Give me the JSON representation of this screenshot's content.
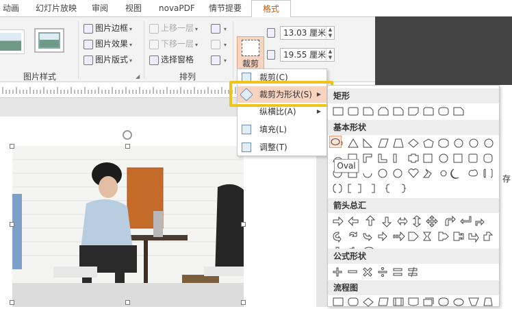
{
  "tabs": [
    "动画",
    "幻灯片放映",
    "审阅",
    "视图",
    "novaPDF",
    "情节提要",
    "格式"
  ],
  "ribbon": {
    "picture_border": "图片边框",
    "picture_effect": "图片效果",
    "picture_layout": "图片版式",
    "bring_forward": "上移一层",
    "send_backward": "下移一层",
    "selection_pane": "选择窗格",
    "crop": "裁剪",
    "height": "13.03 厘米",
    "width": "19.55 厘米",
    "group_picture_styles": "图片样式",
    "group_arrange": "排列"
  },
  "menu": {
    "crop": "裁剪(C)",
    "crop_to_shape": "裁剪为形状(S)",
    "aspect_ratio": "纵横比(A)",
    "fill": "填充(L)",
    "fit": "调整(T)"
  },
  "gallery": {
    "rect": "矩形",
    "basic": "基本形状",
    "arrows": "箭头总汇",
    "equation": "公式形状",
    "flowchart": "流程图",
    "tooltip": "Oval"
  },
  "side_text": "存",
  "colors": {
    "accent": "#c55a11",
    "highlight": "#f0c419",
    "hover": "#f8d3bf"
  }
}
